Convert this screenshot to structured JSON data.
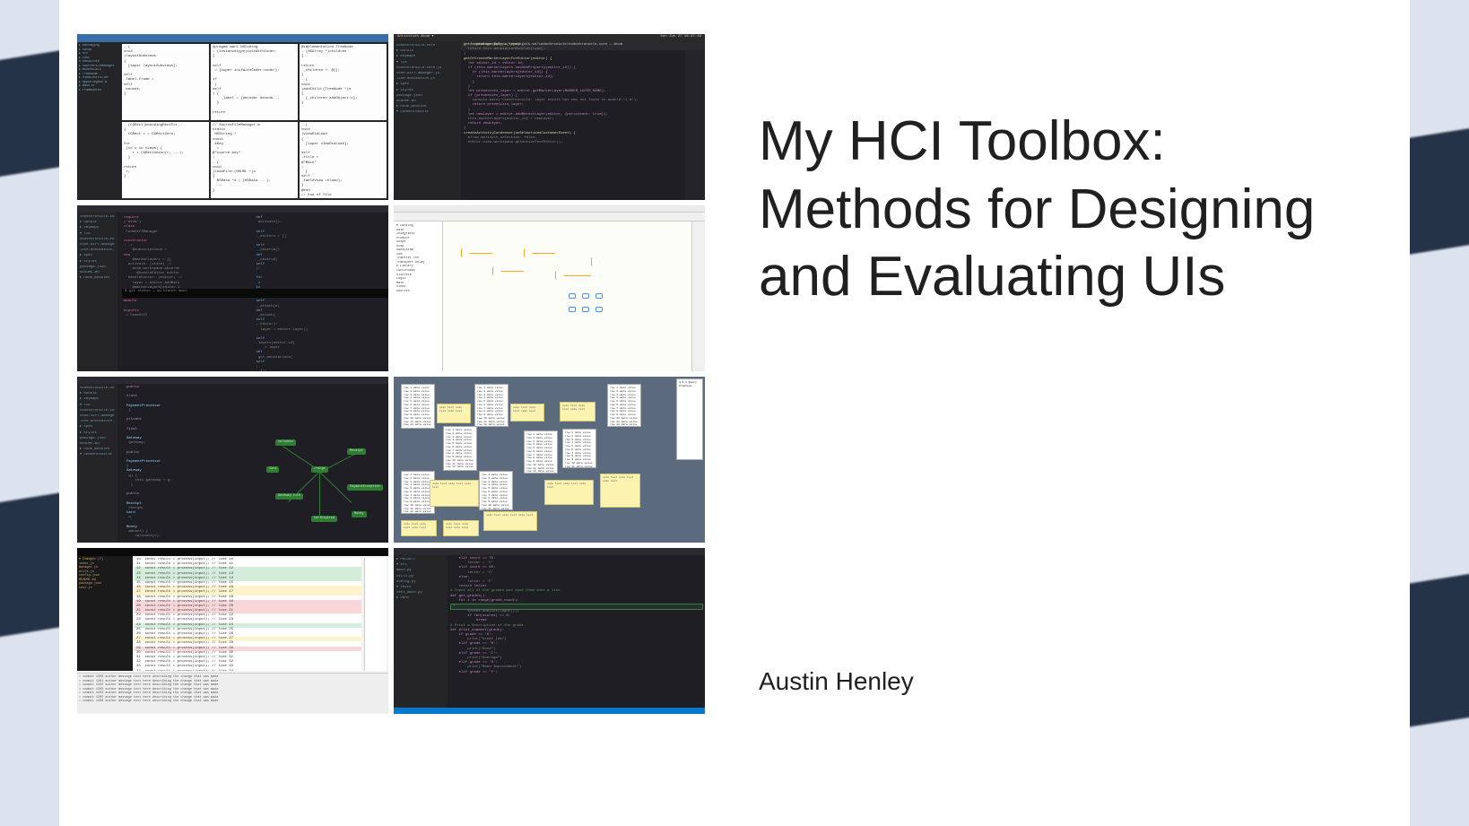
{
  "title_bold": "My HCI Toolbox:",
  "title_rest": "Methods for Designing and Evaluating UIs",
  "author": "Austin Henley",
  "thumbnails": {
    "t2": {
      "topbar_left": "Activities    Atom ▾",
      "topbar_right": "Sun Jun 27 16:37:49",
      "title": "package.json — ~/code/utk-se/codechronicle/codechronicle-core — Atom",
      "sidebar": [
        "codechronicle-core",
        "▸ bundle",
        "▸ keymaps",
        "▾ lib",
        "  codechronicle-core.js",
        "  code-diff-manager.js",
        "  line-annotation.js",
        "▸ spec",
        "▸ styles",
        "  package.json",
        "  README.md",
        "▸ node_modules",
        "▾ codechronicle"
      ],
      "code": [
        {
          "cls": "fn",
          "t": "getAnnotationsByType(type) {"
        },
        {
          "cls": "",
          "t": "  return this.annotationModules[type];"
        },
        {
          "cls": "",
          "t": "}"
        },
        {
          "cls": "",
          "t": ""
        },
        {
          "cls": "fn",
          "t": "getOrCreateMarkerLayerForEditor(editor) {"
        },
        {
          "cls": "kw",
          "t": "  let editor_id = editor.id;"
        },
        {
          "cls": "kw",
          "t": "  if (this.markerLayers.hasOwnProperty(editor_id)) {"
        },
        {
          "cls": "kw",
          "t": "    if (this.markerLayers[editor_id]) {"
        },
        {
          "cls": "kw",
          "t": "      return this.markerLayers[editor_id];"
        },
        {
          "cls": "",
          "t": "    }"
        },
        {
          "cls": "",
          "t": "  }"
        },
        {
          "cls": "kw",
          "t": "  let prevexists_layer = editor.getMarkerLayer(MARKER_LAYER_NAME);"
        },
        {
          "cls": "kw",
          "t": "  if (prevexists_layer) {"
        },
        {
          "cls": "",
          "t": "    console.warn('CodeChronicle: layer exists but was not found in module\\'s m');"
        },
        {
          "cls": "kw",
          "t": "    return prevexists_layer;"
        },
        {
          "cls": "",
          "t": "  }"
        },
        {
          "cls": "kw",
          "t": "  let newLayer = editor.addMarkerLayer(editor, {persistent: true});"
        },
        {
          "cls": "",
          "t": "  this.markerLayers[editor_id] = newLayer;"
        },
        {
          "cls": "kw",
          "t": "  return newLayer;"
        },
        {
          "cls": "",
          "t": "}"
        },
        {
          "cls": "",
          "t": ""
        },
        {
          "cls": "fn",
          "t": "createActivityCondenser(onSelectionsCustomerEvent) {"
        },
        {
          "cls": "",
          "t": "  allow_multiple_selection: false,"
        },
        {
          "cls": "",
          "t": "  editor.view.workspace.getActiveTextEditor();"
        }
      ]
    },
    "t1": {
      "sidebar": [
        "▸ packaging",
        "▸ setup",
        "▸ src",
        "▸ test",
        "▾ Resources",
        "  ▸ SourceFileManager",
        "  ▸ BoundsCalc",
        "  ▸ TreeNode",
        "  ▸ ViewController",
        "  ▸ AppDelegate.m",
        "  ▸ main.m",
        "▸ Frameworks"
      ],
      "panes": [
        [
          "- (void)layoutSubviews",
          "{",
          "  [super layoutSubviews];",
          "  self.label.frame = self.bounds;",
          "}"
        ],
        [
          "#pragma mark NSCoding",
          "",
          "- (instancetype)initWithCoder:",
          "{",
          "  self = [super initWithCoder:coder];",
          "  if (self) {",
          "    _label = [decoder decode...",
          "  }",
          "  return self;",
          "}"
        ],
        [
          "@implementation TreeNode",
          "",
          "- (NSArray *)children",
          "{",
          "  return _children ?: @[];",
          "}",
          "",
          "- (void)addChild:(TreeNode *)n",
          "{",
          "  [_children addObject:n];",
          "}"
        ],
        [
          "- (CGRect)boundingRectFor..",
          "{",
          "  CGRect r = CGRectZero;",
          "  for (id v in views) {",
          "    r = CGRectUnion(r, ...);",
          "  }",
          "  return r;",
          "}"
        ],
        [
          "// SourceFileManager.m",
          "",
          "static NSString *const kKey",
          "  = @\"source.key\";",
          "",
          "- (void)loadFile:(NSURL *)u",
          "{",
          "  NSData *d = [NSData ...];",
          "  ...",
          "}"
        ],
        [
          "- (void)viewDidLoad",
          "{",
          "  [super viewDidLoad];",
          "  self.title = @\"Main\";",
          "  [self.tableView reload];",
          "}",
          "",
          "@end",
          "",
          "// End of file"
        ]
      ]
    },
    "t3": {
      "left": [
        "require('atom')",
        "",
        "class CodeDiffManager",
        "  constructor: ->",
        "    @subscriptions = new",
        "    @markerLayers = {}",
        "",
        "  activate: (state) ->",
        "    atom.workspace.observe",
        "      @handleEditor editor",
        "",
        "  handleEditor: (editor) ->",
        "    layer = editor.addMark",
        "    @markerLayers[editor.i",
        "",
        "  deactivate: ->",
        "    @subscriptions.dispose",
        "",
        "module.exports = CodeDiff"
      ],
      "right": [
        "def activate():",
        "  self._editors = []",
        "  self._observe()",
        "",
        "def _observe(self):",
        "  for e in atom.editors:",
        "    self._attach(e)",
        "",
        "def _attach(self, editor):",
        "  layer = editor.layer()",
        "  self.layers[editor.id]",
        "    = layer",
        "",
        "def get_annotations(self,",
        "  t):",
        "  return self.ann[t]",
        "",
        "def save_state(self):",
        "  return {...}"
      ]
    },
    "t4": {
      "sidebar": [
        "▾ Catalog",
        "  Gain",
        "  Integrator",
        "  Product",
        "  Scope",
        "  Step",
        "  Subsystem",
        "  Sum",
        "  Transfer Fcn",
        "  Transport Delay",
        "▾ Library",
        "  Continuous",
        "  Discrete",
        "  Logic",
        "  Math",
        "  Sinks",
        "  Sources"
      ]
    },
    "t5": {
      "code": [
        "public class PaymentProcessor {",
        "  private final Gateway gateway;",
        "",
        "  public PaymentProcessor(Gateway g) {",
        "    this.gateway = g;",
        "  }",
        "",
        "  public Receipt charge(Card c,",
        "      Money amount) {",
        "    validate(c);",
        "    AuthResult r = gateway.auth(c,",
        "        amount);",
        "    if (!r.ok()) {",
        "      throw new PaymentException();",
        "    }",
        "    return new Receipt(r.id(),",
        "        amount);",
        "  }",
        "",
        "  private void validate(Card c) {",
        "    if (c.expired())",
        "      throw new CardExpired();",
        "  }",
        "}"
      ],
      "nodes": [
        "charge",
        "validate",
        "Gateway.auth",
        "Receipt",
        "PaymentException",
        "CardExpired",
        "Money",
        "Card"
      ]
    },
    "t6": {
      "rpanel": "4.2.1 Query Creation"
    },
    "t7": {
      "sidebar": [
        "▾ Changes (7)",
        "  index.js",
        "  manager.js",
        "  utils.js",
        "  config.json",
        "  README.md",
        "  package.json",
        "  test.js"
      ]
    },
    "t8": {
      "sidebar": [
        "▸ PROJECT",
        "▾ src",
        "  main.py",
        "  utils.py",
        "  config.py",
        "▾ tests",
        "  test_main.py",
        "▸ venv"
      ],
      "code": [
        {
          "cls": "py-kw",
          "t": "    elif score >= 70:"
        },
        {
          "cls": "",
          "t": "        letter = 'C'"
        },
        {
          "cls": "py-kw",
          "t": "    elif score >= 60:"
        },
        {
          "cls": "",
          "t": "        letter = 'D'"
        },
        {
          "cls": "py-kw",
          "t": "    else:"
        },
        {
          "cls": "",
          "t": "        letter = 'F'"
        },
        {
          "cls": "py-kw",
          "t": "    return letter"
        },
        {
          "cls": "",
          "t": ""
        },
        {
          "cls": "py-com",
          "t": "# Input all of the grades and save them into a list."
        },
        {
          "cls": "py-kw",
          "t": "def get_grades():"
        },
        {
          "cls": "py-kw",
          "t": "    for i in range(grade_count): ?",
          "hint": true
        },
        {
          "cls": "",
          "t": "        scores.add(int(input()))"
        },
        {
          "cls": "py-kw",
          "t": "        if len(scores) == 0:"
        },
        {
          "cls": "py-kw",
          "t": "            break"
        },
        {
          "cls": "",
          "t": ""
        },
        {
          "cls": "py-com",
          "t": "# Print a description of the grade."
        },
        {
          "cls": "py-kw",
          "t": "def print_comment(grade):"
        },
        {
          "cls": "py-kw",
          "t": "    if grade == 'A':"
        },
        {
          "cls": "",
          "t": "        print(\"Great job\")"
        },
        {
          "cls": "py-kw",
          "t": "    elif grade == 'B':"
        },
        {
          "cls": "",
          "t": "        print(\"Good\")"
        },
        {
          "cls": "py-kw",
          "t": "    elif grade == 'C':"
        },
        {
          "cls": "",
          "t": "        print(\"Average\")"
        },
        {
          "cls": "py-kw",
          "t": "    elif grade == 'D':"
        },
        {
          "cls": "",
          "t": "        print(\"Need Improvement\")"
        },
        {
          "cls": "py-kw",
          "t": "    elif grade == 'F':"
        }
      ]
    }
  }
}
